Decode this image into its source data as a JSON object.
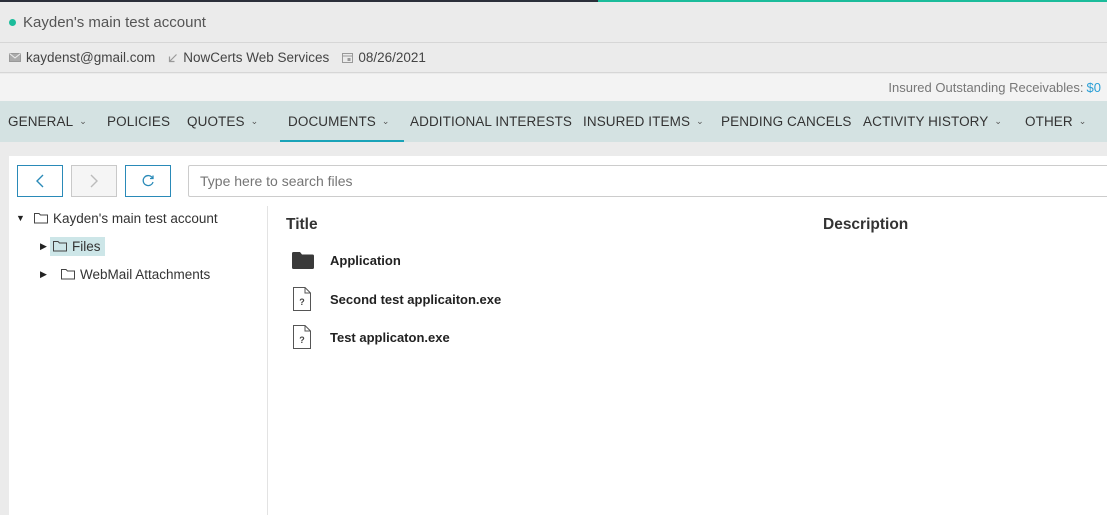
{
  "account": {
    "title": "Kayden's main test account",
    "status_color": "#1bbc9b"
  },
  "info": {
    "email": "kaydenst@gmail.com",
    "source": "NowCerts Web Services",
    "date": "08/26/2021"
  },
  "receivables": {
    "label": "Insured Outstanding Receivables:",
    "amount": "$0"
  },
  "nav": {
    "general": "GENERAL",
    "policies": "POLICIES",
    "quotes": "QUOTES",
    "documents": "DOCUMENTS",
    "additional_interests": "ADDITIONAL INTERESTS",
    "insured_items": "INSURED ITEMS",
    "pending_cancels": "PENDING CANCELS",
    "activity_history": "ACTIVITY HISTORY",
    "other": "OTHER",
    "active": "DOCUMENTS"
  },
  "search": {
    "placeholder": "Type here to search files"
  },
  "tree": {
    "root": "Kayden's main test account",
    "children": [
      "Files",
      "WebMail Attachments"
    ],
    "selected": "Files"
  },
  "table": {
    "columns": [
      "Title",
      "Description"
    ],
    "rows": [
      {
        "title": "Application",
        "icon": "folder-icon"
      },
      {
        "title": "Second test applicaiton.exe",
        "icon": "unknown-file-icon"
      },
      {
        "title": "Test applicaton.exe",
        "icon": "unknown-file-icon"
      }
    ]
  },
  "colors": {
    "accent": "#1aa3b8",
    "link": "#2a9fd6",
    "nav_bg": "#d4e2e2",
    "selected_bg": "#cde6e8"
  }
}
